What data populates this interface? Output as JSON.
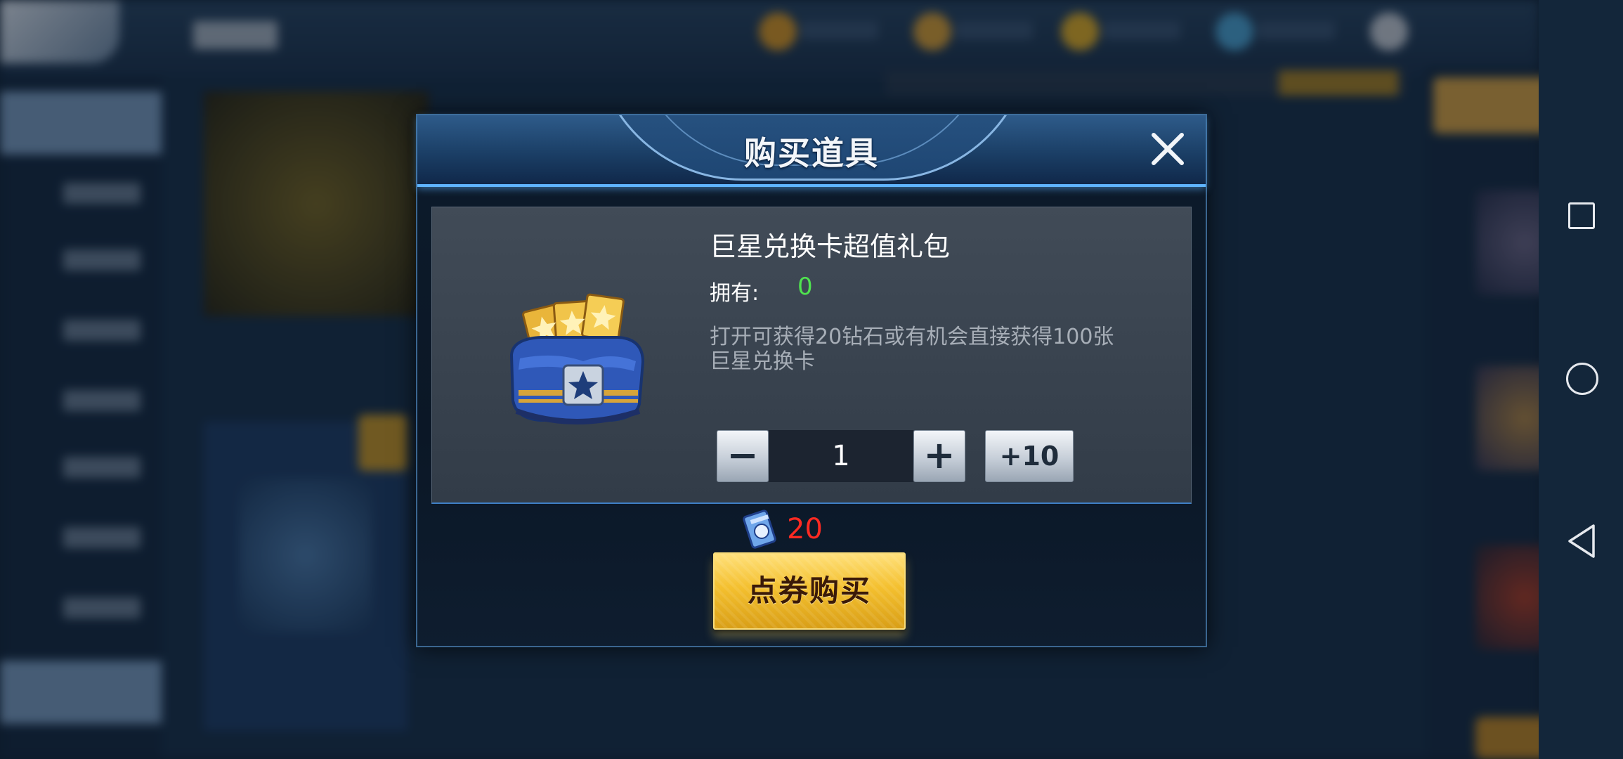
{
  "dialog": {
    "title": "购买道具",
    "close_icon": "close-icon"
  },
  "item": {
    "name": "巨星兑换卡超值礼包",
    "own_label": "拥有:",
    "own_value": "0",
    "description": "打开可获得20钻石或有机会直接获得100张巨星兑换卡",
    "icon": "gift-bag-icon"
  },
  "quantity": {
    "minus_label": "−",
    "value": "1",
    "plus_label": "+",
    "plus10_label": "+10"
  },
  "price": {
    "icon": "coupon-icon",
    "value": "20"
  },
  "buy_button": {
    "label": "点券购买"
  },
  "nav": {
    "recent": "square-recent-icon",
    "home": "circle-home-icon",
    "back": "triangle-back-icon"
  },
  "colors": {
    "own_value": "#4fe24f",
    "price": "#ff2a22",
    "buy_button": "#f4c02f",
    "header_accent": "#5fb4ff"
  }
}
